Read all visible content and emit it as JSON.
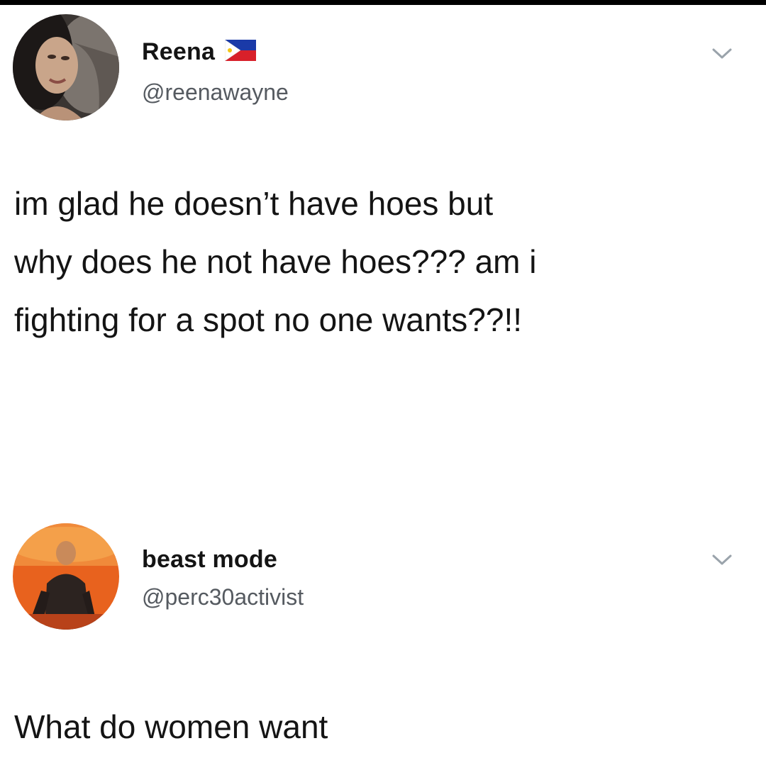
{
  "tweets": [
    {
      "display_name": "Reena",
      "handle": "@reenawayne",
      "flag_icon": "philippines-flag-icon",
      "text": "im glad he doesn’t have hoes but\nwhy does he not have hoes??? am i\nfighting for a spot no one wants??!!"
    },
    {
      "display_name": "beast mode",
      "handle": "@perc30activist",
      "text": "What do women want"
    }
  ],
  "icons": {
    "menu": "chevron-down-icon"
  },
  "colors": {
    "background": "#ffffff",
    "text": "#141414",
    "handle": "#555a60",
    "chevron": "#9aa3ab"
  }
}
